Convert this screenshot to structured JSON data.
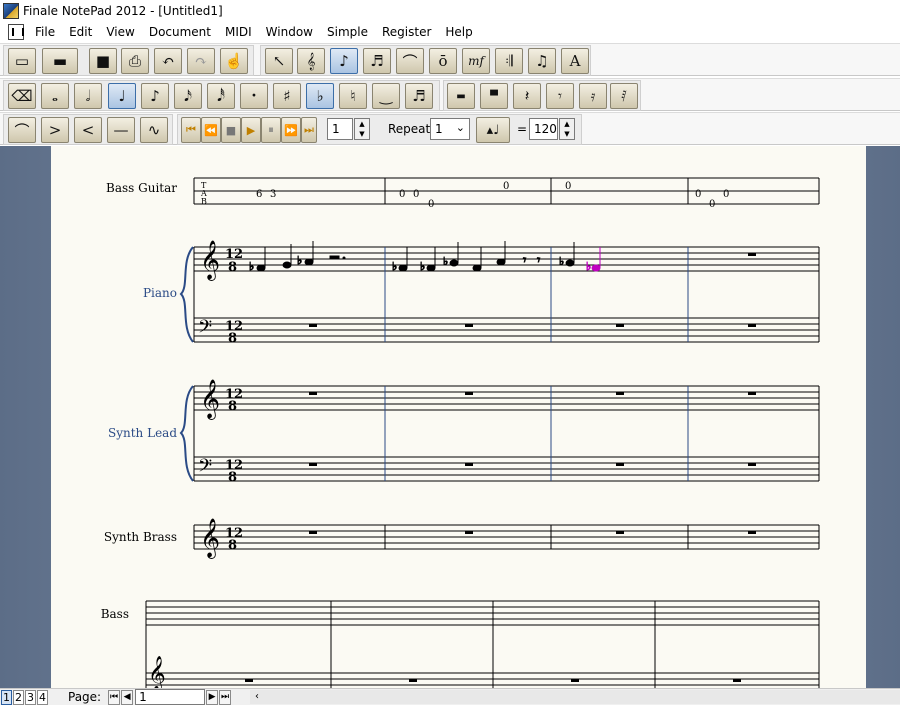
{
  "window": {
    "title": "Finale NotePad 2012 - [Untitled1]"
  },
  "menu": {
    "items": [
      "File",
      "Edit",
      "View",
      "Document",
      "MIDI",
      "Window",
      "Simple",
      "Register",
      "Help"
    ]
  },
  "toolbar1": {
    "buttons": [
      {
        "name": "new-icon",
        "glyph": "▭"
      },
      {
        "name": "open-icon",
        "glyph": "▬"
      },
      {
        "name": "save-icon",
        "glyph": "■"
      },
      {
        "name": "print-icon",
        "glyph": "⎙"
      },
      {
        "name": "undo-icon",
        "glyph": "↶"
      },
      {
        "name": "redo-icon",
        "glyph": "↷"
      },
      {
        "name": "hand-icon",
        "glyph": "☝"
      },
      {
        "name": "selection-tool-icon",
        "glyph": "↖"
      },
      {
        "name": "staff-tool-icon",
        "glyph": "𝄞"
      },
      {
        "name": "simple-entry-tool-icon",
        "glyph": "♪"
      },
      {
        "name": "tuplet-tool-icon",
        "glyph": "♬"
      },
      {
        "name": "smart-shape-tool-icon",
        "glyph": "⌒"
      },
      {
        "name": "articulation-tool-icon",
        "glyph": "ō"
      },
      {
        "name": "expression-tool-icon",
        "glyph": "mf"
      },
      {
        "name": "repeat-tool-icon",
        "glyph": "𝄇"
      },
      {
        "name": "lyrics-tool-icon",
        "glyph": "♫"
      },
      {
        "name": "text-tool-icon",
        "glyph": "A"
      }
    ]
  },
  "toolbar2": {
    "buttons": [
      {
        "name": "eraser-icon",
        "glyph": "⌫"
      },
      {
        "name": "whole-note-icon",
        "glyph": "𝅝"
      },
      {
        "name": "half-note-icon",
        "glyph": "𝅗𝅥"
      },
      {
        "name": "quarter-note-icon",
        "glyph": "♩"
      },
      {
        "name": "eighth-note-icon",
        "glyph": "♪"
      },
      {
        "name": "sixteenth-note-icon",
        "glyph": "𝅘𝅥𝅯"
      },
      {
        "name": "thirty-second-note-icon",
        "glyph": "𝅘𝅥𝅰"
      },
      {
        "name": "dot-icon",
        "glyph": "·"
      },
      {
        "name": "sharp-icon",
        "glyph": "♯"
      },
      {
        "name": "flat-icon",
        "glyph": "♭"
      },
      {
        "name": "natural-icon",
        "glyph": "♮"
      },
      {
        "name": "tie-icon",
        "glyph": "‿"
      },
      {
        "name": "tuplet-icon",
        "glyph": "♬"
      },
      {
        "name": "whole-rest-icon",
        "glyph": "▬"
      },
      {
        "name": "half-rest-icon",
        "glyph": "▀"
      },
      {
        "name": "quarter-rest-icon",
        "glyph": "𝄽"
      },
      {
        "name": "eighth-rest-icon",
        "glyph": "𝄾"
      },
      {
        "name": "sixteenth-rest-icon",
        "glyph": "𝄿"
      },
      {
        "name": "thirty-second-rest-icon",
        "glyph": "𝅀"
      }
    ]
  },
  "toolbar3": {
    "shape_buttons": [
      {
        "name": "slur-icon",
        "glyph": "⌒"
      },
      {
        "name": "decrescendo-icon",
        "glyph": ">"
      },
      {
        "name": "crescendo-icon",
        "glyph": "<"
      },
      {
        "name": "line-icon",
        "glyph": "—"
      },
      {
        "name": "bend-icon",
        "glyph": "∿"
      }
    ],
    "playback_buttons": [
      {
        "name": "rewind-to-start-icon",
        "glyph": "⏮"
      },
      {
        "name": "rewind-icon",
        "glyph": "⏪"
      },
      {
        "name": "stop-icon",
        "glyph": "■"
      },
      {
        "name": "play-icon",
        "glyph": "▶"
      },
      {
        "name": "pause-icon",
        "glyph": "⏸"
      },
      {
        "name": "fast-forward-icon",
        "glyph": "⏩"
      },
      {
        "name": "forward-to-end-icon",
        "glyph": "⏭"
      }
    ],
    "measure_value": "1",
    "repeat_label": "Repeat:",
    "repeat_value": "1",
    "tempo_equals": "=",
    "tempo_value": "120"
  },
  "score": {
    "staves": [
      {
        "label": "Bass Guitar",
        "color": "#000000"
      },
      {
        "label": "Piano",
        "color": "#2b4b86"
      },
      {
        "label": "Synth Lead",
        "color": "#2b4b86"
      },
      {
        "label": "Synth Brass",
        "color": "#000000"
      },
      {
        "label": "Bass",
        "color": "#000000"
      }
    ],
    "tab_numbers": [
      {
        "measure": 1,
        "values": [
          "6",
          "3"
        ]
      },
      {
        "measure": 2,
        "values": [
          "0",
          "0",
          "0",
          "0"
        ]
      },
      {
        "measure": 3,
        "values": [
          "0"
        ]
      },
      {
        "measure": 4,
        "values": [
          "0",
          "0",
          "0"
        ]
      }
    ],
    "time_signature": "12/8",
    "highlight_color": "#c000c0"
  },
  "status": {
    "page_tabs": [
      "1",
      "2",
      "3",
      "4"
    ],
    "page_label": "Page:",
    "page_value": "1"
  }
}
